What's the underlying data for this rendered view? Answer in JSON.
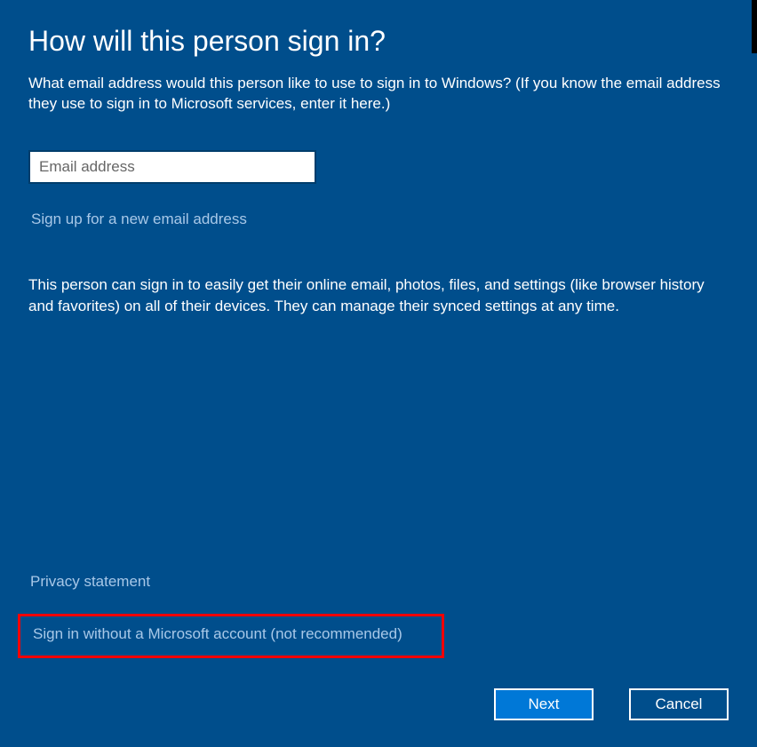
{
  "dialog": {
    "title": "How will this person sign in?",
    "description": "What email address would this person like to use to sign in to Windows? (If you know the email address they use to sign in to Microsoft services, enter it here.)",
    "email_placeholder": "Email address",
    "signup_link": "Sign up for a new email address",
    "info_text": "This person can sign in to easily get their online email, photos, files, and settings (like browser history and favorites) on all of their devices. They can manage their synced settings at any time.",
    "privacy_link": "Privacy statement",
    "no_account_link": "Sign in without a Microsoft account (not recommended)",
    "next_button": "Next",
    "cancel_button": "Cancel"
  }
}
